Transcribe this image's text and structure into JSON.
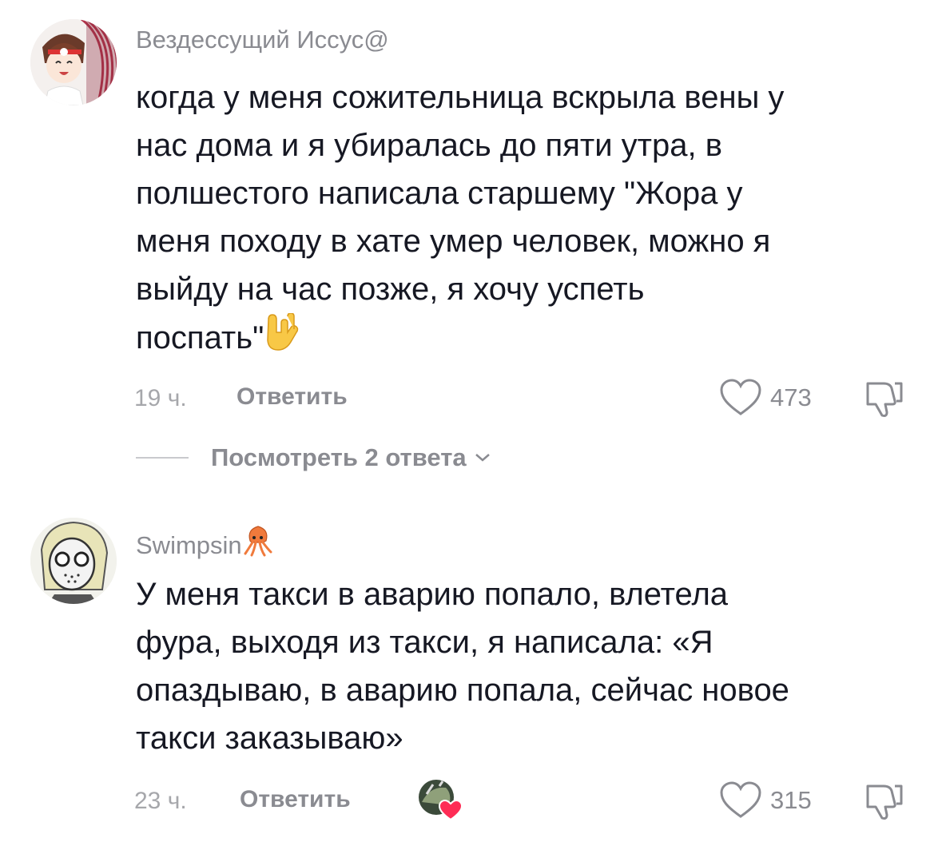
{
  "comments": [
    {
      "author": "Вездессущий Иссус@",
      "lines": [
        "когда у меня сожительница вскрыла вены у",
        "нас дома и я убиралась до пяти утра, в",
        "полшестого написала старшему \"Жора у",
        "меня походу в хате умер человек, можно я",
        "выйду на час позже, я хочу успеть",
        "поспать\""
      ],
      "emoji_icon": "sign-of-the-horns-icon",
      "time": "19 ч.",
      "reply_label": "Ответить",
      "likes": "473",
      "view_replies": "Посмотреть 2 ответа"
    },
    {
      "author": "Swimpsin",
      "author_emoji_icon": "squid-icon",
      "lines": [
        "У меня такси в аварию попало, влетела",
        "фура, выходя из такси, я написала: «Я",
        "опаздываю, в аварию попала, сейчас новое",
        "такси заказываю»"
      ],
      "time": "23 ч.",
      "reply_label": "Ответить",
      "likes": "315",
      "creator_liked_icon": "creator-liked-avatar-icon"
    }
  ],
  "colors": {
    "text": "#161823",
    "secondary": "#8a8b91",
    "heart": "#fe2c55"
  }
}
